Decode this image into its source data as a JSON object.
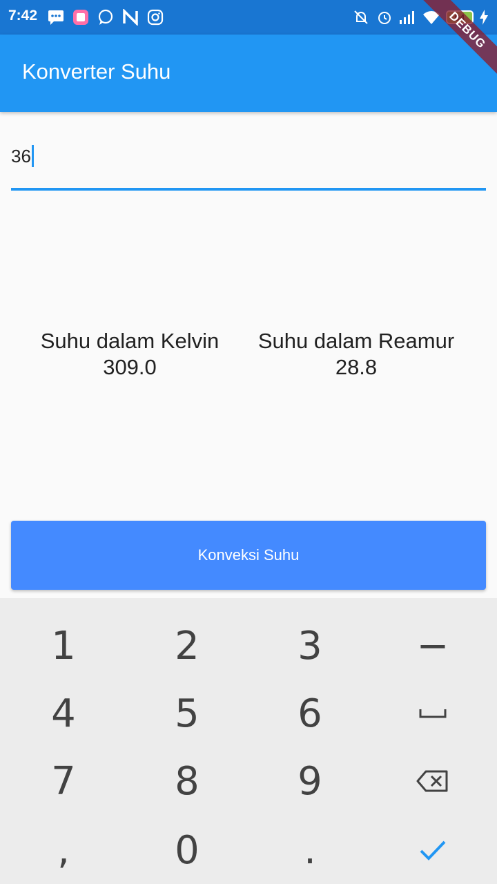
{
  "status_bar": {
    "time": "7:42",
    "left_icons": [
      "message-icon",
      "app-icon",
      "whatsapp-icon",
      "n-app-icon",
      "instagram-icon"
    ],
    "right_icons": [
      "alarm-off-icon",
      "alarm-icon",
      "signal-icon",
      "wifi-icon"
    ],
    "battery": "94",
    "debug_label": "DEBUG"
  },
  "app_bar": {
    "title": "Konverter Suhu"
  },
  "input": {
    "value": "36"
  },
  "results": {
    "kelvin": {
      "label": "Suhu dalam Kelvin",
      "value": "309.0"
    },
    "reamur": {
      "label": "Suhu dalam Reamur",
      "value": "28.8"
    }
  },
  "button": {
    "label": "Konveksi Suhu"
  },
  "keyboard": {
    "rows": [
      [
        "1",
        "2",
        "3",
        "−"
      ],
      [
        "4",
        "5",
        "6",
        "space-icon"
      ],
      [
        "7",
        "8",
        "9",
        "backspace-icon"
      ],
      [
        ",",
        "0",
        ".",
        "check-icon"
      ]
    ]
  },
  "colors": {
    "status_bar": "#1976d2",
    "app_bar": "#2196f3",
    "button": "#448aff",
    "keyboard_bg": "#ececec",
    "check": "#2196f3"
  }
}
